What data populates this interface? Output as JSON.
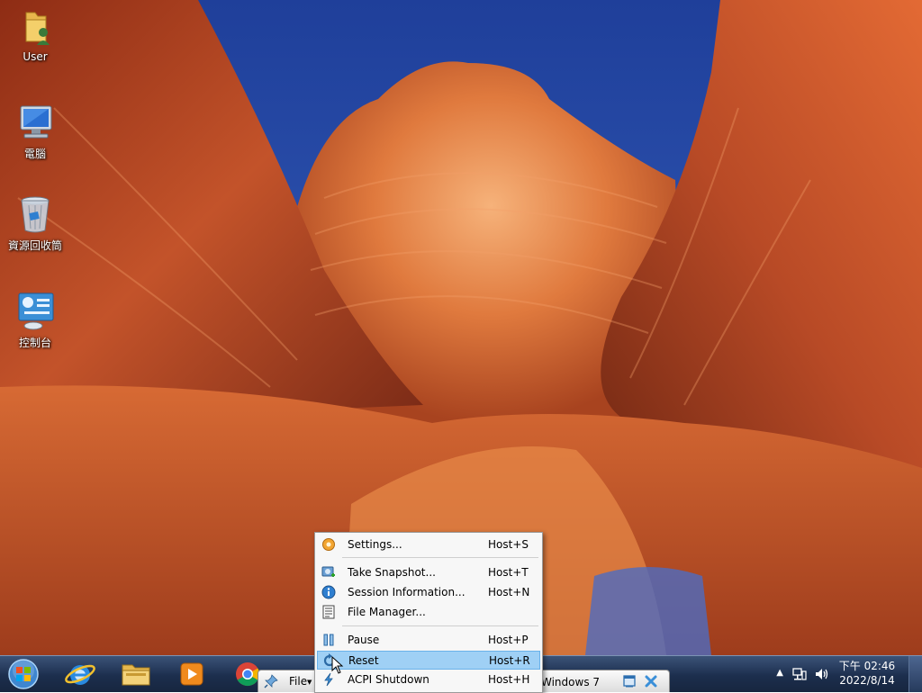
{
  "desktop": {
    "icons": [
      {
        "label": "User",
        "icon": "user-folder-icon"
      },
      {
        "label": "電腦",
        "icon": "computer-icon"
      },
      {
        "label": "資源回收筒",
        "icon": "recycle-bin-icon"
      },
      {
        "label": "控制台",
        "icon": "control-panel-icon"
      }
    ]
  },
  "vbox_toolbar": {
    "file_label": "File",
    "vm_title": "Windows 7"
  },
  "menu": {
    "items": [
      {
        "label": "Settings...",
        "shortcut": "Host+S",
        "icon": "settings-icon"
      },
      {
        "label": "Take Snapshot...",
        "shortcut": "Host+T",
        "icon": "snapshot-icon"
      },
      {
        "label": "Session Information...",
        "shortcut": "Host+N",
        "icon": "info-icon"
      },
      {
        "label": "File Manager...",
        "shortcut": "",
        "icon": "file-manager-icon"
      },
      {
        "label": "Pause",
        "shortcut": "Host+P",
        "icon": "pause-icon"
      },
      {
        "label": "Reset",
        "shortcut": "Host+R",
        "icon": "reset-icon"
      },
      {
        "label": "ACPI Shutdown",
        "shortcut": "Host+H",
        "icon": "acpi-shutdown-icon"
      }
    ],
    "highlighted": "Reset"
  },
  "clock": {
    "time": "下午 02:46",
    "date": "2022/8/14"
  },
  "colors": {
    "taskbar": "#1c2e4d",
    "menu_highlight": "#9fd0f5",
    "sky": "#2a4fa8",
    "rock": "#c8552b"
  }
}
